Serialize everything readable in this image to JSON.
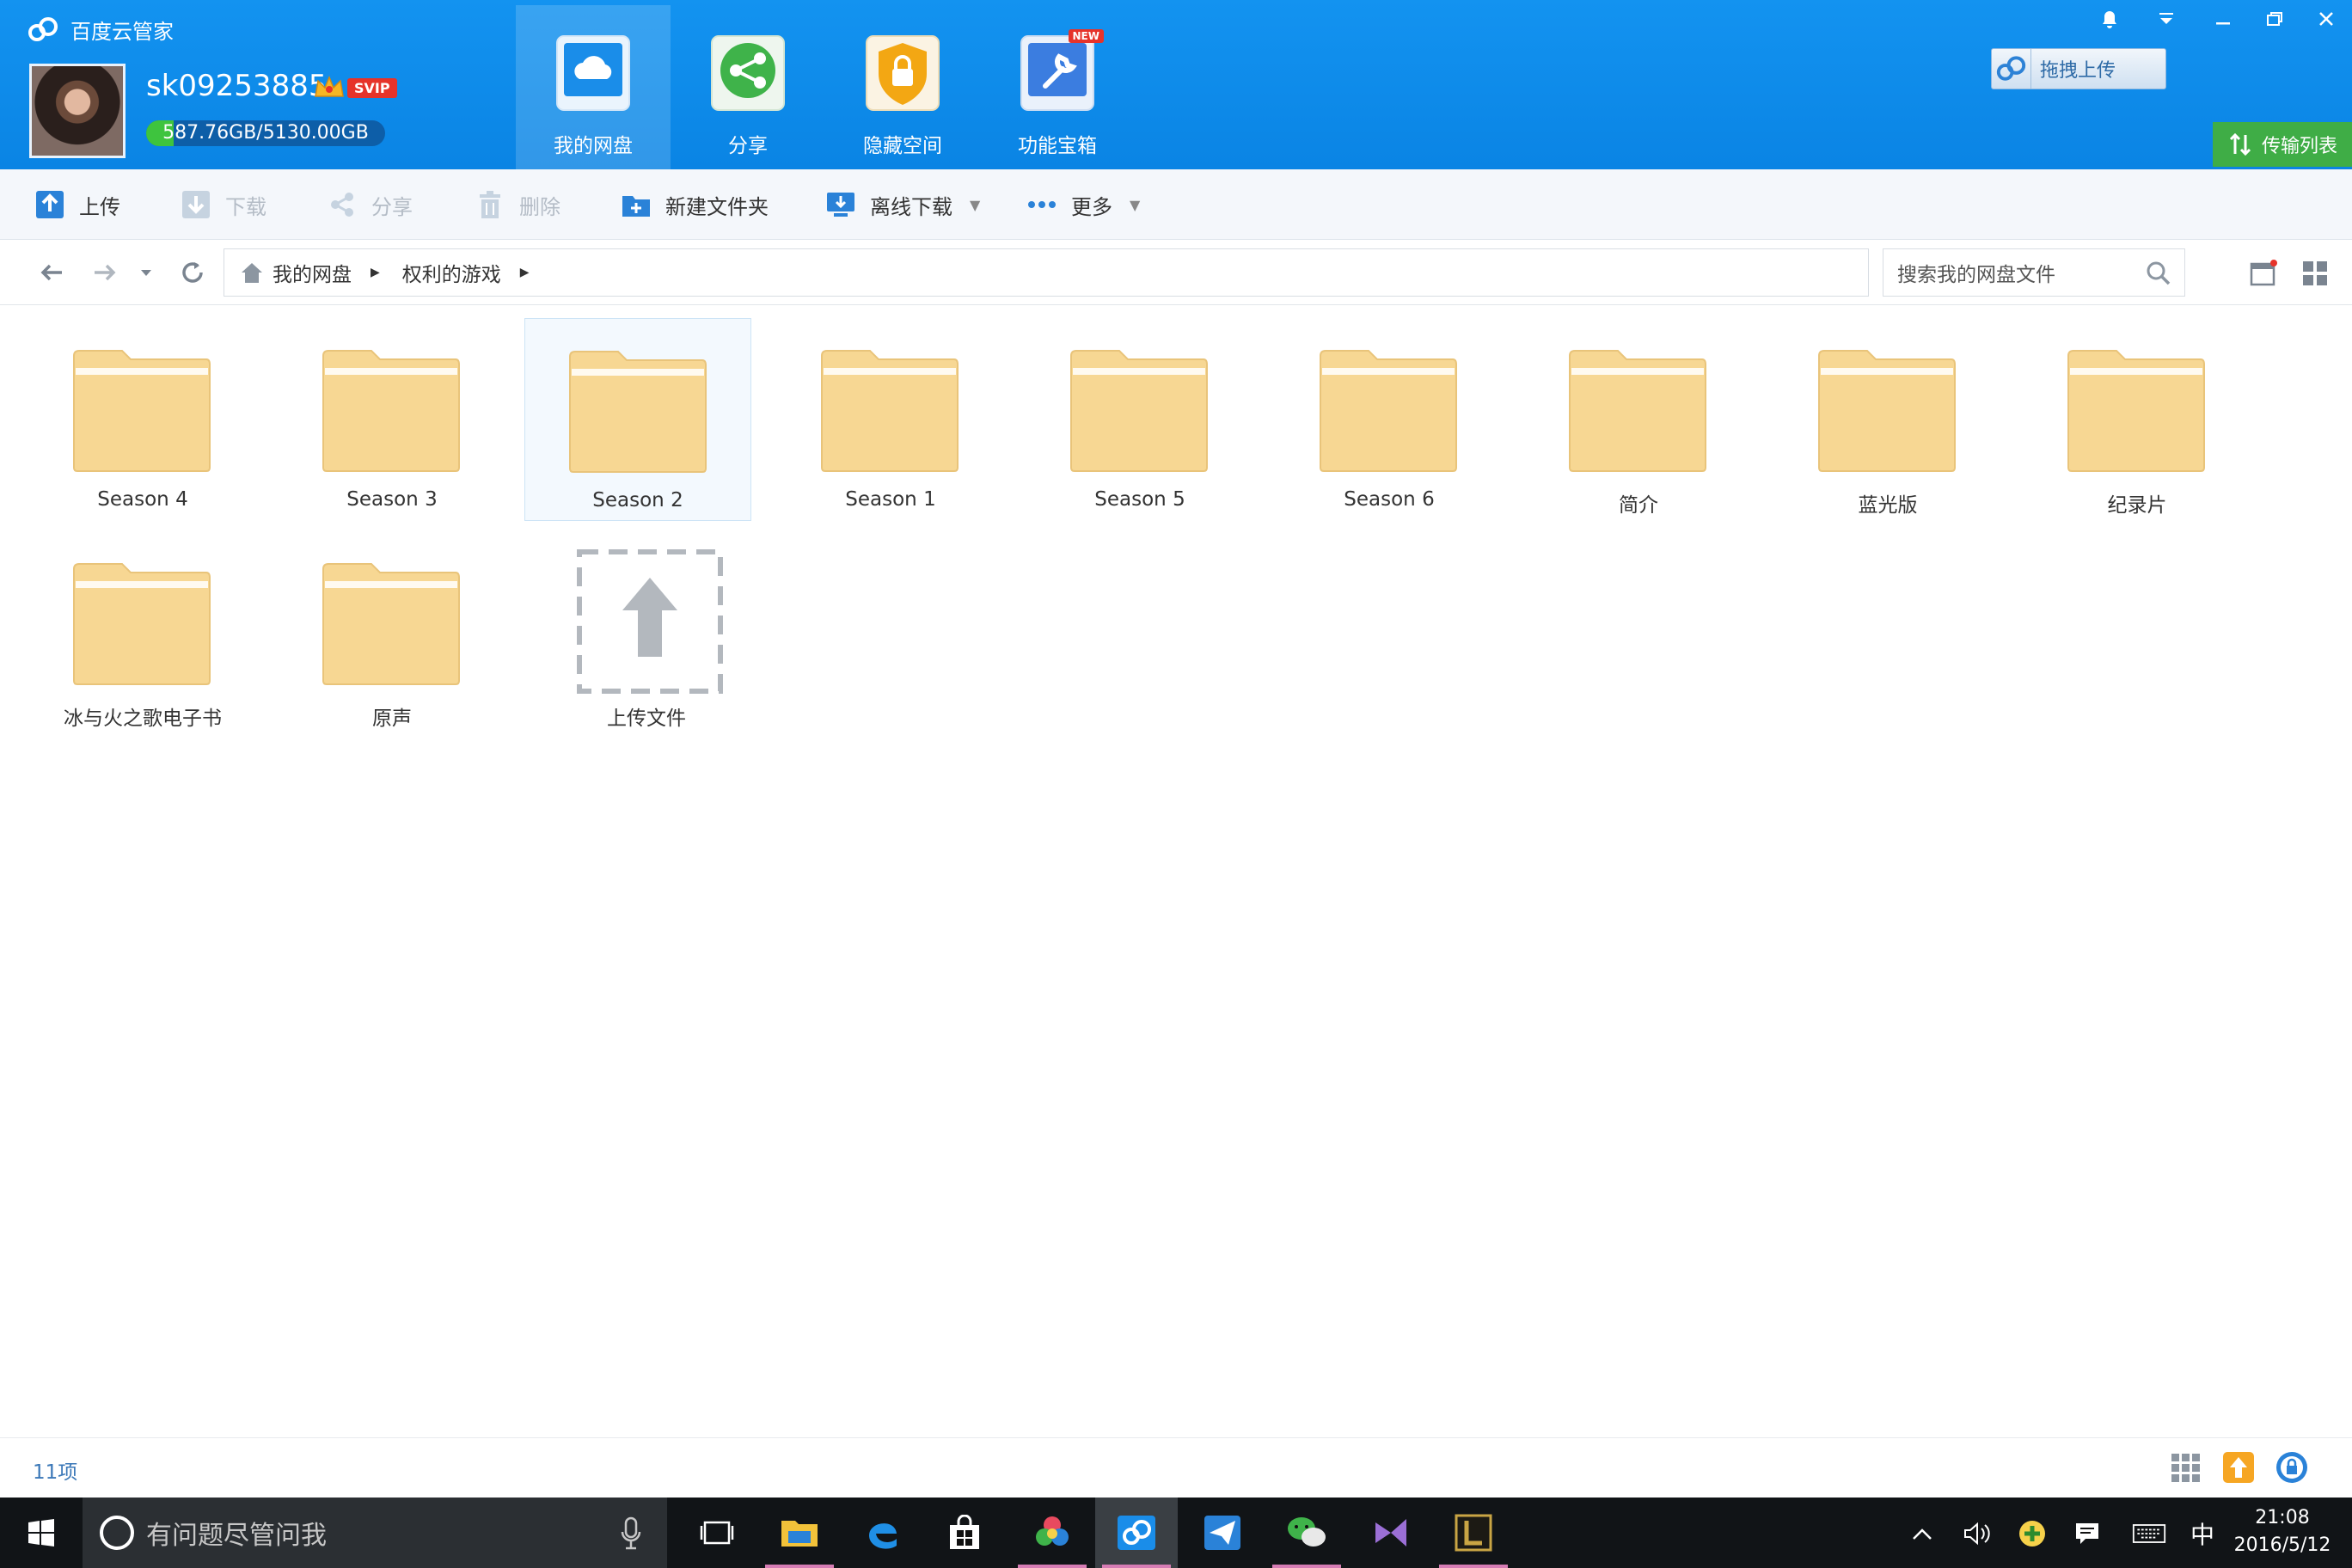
{
  "app": {
    "title": "百度云管家"
  },
  "user": {
    "name": "sk09253885",
    "badge": "SVIP",
    "quota_text": "587.76GB/5130.00GB",
    "quota_fraction": 0.115
  },
  "main_tabs": [
    {
      "label": "我的网盘",
      "icon": "cloud-icon",
      "active": true
    },
    {
      "label": "分享",
      "icon": "share-icon",
      "active": false
    },
    {
      "label": "隐藏空间",
      "icon": "lock-shield-icon",
      "active": false
    },
    {
      "label": "功能宝箱",
      "icon": "toolbox-icon",
      "active": false,
      "badge": "NEW"
    }
  ],
  "header_buttons": {
    "drag_upload": "拖拽上传",
    "transfer_list": "传输列表"
  },
  "toolbar": {
    "upload": "上传",
    "download": "下载",
    "share": "分享",
    "delete": "删除",
    "new_folder": "新建文件夹",
    "offline_download": "离线下载",
    "more": "更多"
  },
  "breadcrumb": {
    "root": "我的网盘",
    "current": "权利的游戏"
  },
  "search": {
    "placeholder": "搜索我的网盘文件"
  },
  "files": [
    {
      "name": "Season 4"
    },
    {
      "name": "Season 3"
    },
    {
      "name": "Season 2",
      "selected": true
    },
    {
      "name": "Season 1"
    },
    {
      "name": "Season 5"
    },
    {
      "name": "Season 6"
    },
    {
      "name": "简介"
    },
    {
      "name": "蓝光版"
    },
    {
      "name": "纪录片"
    },
    {
      "name": "冰与火之歌电子书"
    },
    {
      "name": "原声"
    }
  ],
  "upload_tile": {
    "label": "上传文件"
  },
  "status": {
    "item_count": "11项"
  },
  "taskbar": {
    "search_placeholder": "有问题尽管问我",
    "apps": [
      "file-explorer-icon",
      "edge-icon",
      "store-icon",
      "photos-icon",
      "baidu-cloud-icon",
      "paper-plane-icon",
      "wechat-icon",
      "visual-studio-icon",
      "league-icon"
    ],
    "ime": "中",
    "time": "21:08",
    "date": "2016/5/12"
  },
  "colors": {
    "header_blue": "#0a84e4",
    "folder": "#f7d793",
    "transfer_green": "#3fad46"
  }
}
